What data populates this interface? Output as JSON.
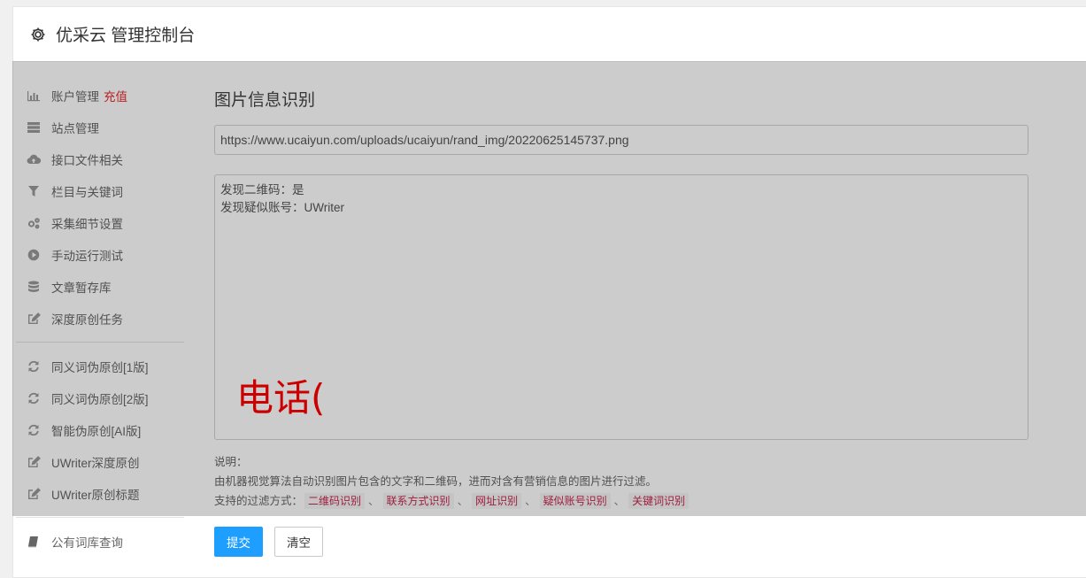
{
  "header": {
    "title": "优采云 管理控制台",
    "icon": "gear-icon"
  },
  "sidebar": {
    "groups": [
      [
        {
          "label": "账户管理",
          "badge": "充值",
          "icon": "bar-chart-icon"
        },
        {
          "label": "站点管理",
          "icon": "server-icon"
        },
        {
          "label": "接口文件相关",
          "icon": "cloud-upload-icon"
        },
        {
          "label": "栏目与关键词",
          "icon": "filter-icon"
        },
        {
          "label": "采集细节设置",
          "icon": "gears-icon"
        },
        {
          "label": "手动运行测试",
          "icon": "play-circle-icon"
        },
        {
          "label": "文章暂存库",
          "icon": "database-icon"
        },
        {
          "label": "深度原创任务",
          "icon": "edit-icon"
        }
      ],
      [
        {
          "label": "同义词伪原创[1版]",
          "icon": "refresh-icon"
        },
        {
          "label": "同义词伪原创[2版]",
          "icon": "refresh-icon"
        },
        {
          "label": "智能伪原创[AI版]",
          "icon": "refresh-icon"
        },
        {
          "label": "UWriter深度原创",
          "icon": "edit-icon"
        },
        {
          "label": "UWriter原创标题",
          "icon": "edit-icon"
        }
      ],
      [
        {
          "label": "公有词库查询",
          "icon": "book-icon"
        }
      ]
    ]
  },
  "main": {
    "title": "图片信息识别",
    "url_value": "https://www.ucaiyun.com/uploads/ucaiyun/rand_img/20220625145737.png",
    "result_lines": [
      "发现二维码：是",
      "发现疑似账号：UWriter"
    ],
    "watermark_text": "电话(",
    "desc_heading": "说明：",
    "desc_text": "由机器视觉算法自动识别图片包含的文字和二维码，进而对含有营销信息的图片进行过滤。",
    "filter_prefix": "支持的过滤方式：",
    "filters": [
      "二维码识别",
      "联系方式识别",
      "网址识别",
      "疑似账号识别",
      "关键词识别"
    ],
    "filter_separator": "、"
  },
  "buttons": {
    "submit": "提交",
    "clear": "清空"
  },
  "colors": {
    "accent": "#1e9fff",
    "danger": "#e8292e",
    "tag_text": "#c7254e",
    "watermark": "#ff0000"
  }
}
